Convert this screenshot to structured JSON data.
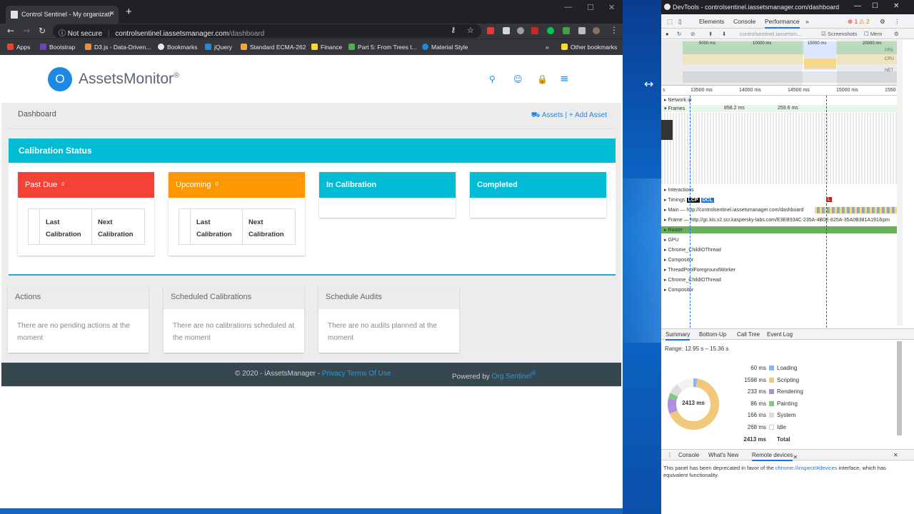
{
  "browser": {
    "tab_title": "Control Sentinel - My organizati",
    "security_label": "Not secure",
    "url_host": "controlsentinel.iassetsmanager.com",
    "url_path": "/dashboard",
    "bookmarks": [
      "Apps",
      "Bootstrap",
      "D3.js - Data-Driven...",
      "Bookmarks",
      "jQuery",
      "Standard ECMA-262",
      "Finance",
      "Part 5: From Trees t...",
      "Material Style"
    ],
    "other_bookmarks": "Other bookmarks"
  },
  "app": {
    "logo_letter": "O",
    "logo_text": "AssetsMonitor",
    "logo_mark": "®",
    "breadcrumb": "Dashboard",
    "assets_link": "Assets",
    "link_sep": "| +",
    "add_asset_link": "Add Asset",
    "calibration": {
      "title": "Calibration Status",
      "cards": [
        {
          "label": "Past Due",
          "count": "0",
          "color": "#f44336",
          "col1": "Last Calibration",
          "col2": "Next Calibration"
        },
        {
          "label": "Upcoming",
          "count": "0",
          "color": "#ff9800",
          "col1": "Last Calibration",
          "col2": "Next Calibration"
        },
        {
          "label": "In Calibration",
          "count": "",
          "color": "#00bcd4"
        },
        {
          "label": "Completed",
          "count": "",
          "color": "#00bcd4"
        }
      ]
    },
    "panels": [
      {
        "title": "Actions",
        "body": "There are no pending actions at the moment"
      },
      {
        "title": "Scheduled Calibrations",
        "body": "There are no calibrations scheduled at the moment"
      },
      {
        "title": "Schedule Audits",
        "body": "There are no audits planned at the moment"
      }
    ],
    "footer": {
      "copy": "© 2020 - iAssetsManager - ",
      "privacy": "Privacy",
      "terms": "Terms Of Use",
      "powered": "Powered by ",
      "org": "Org Sentinel",
      "org_mark": "®"
    }
  },
  "devtools": {
    "title": "DevTools - controlsentinel.iassetsmanager.com/dashboard",
    "tabs": [
      "Elements",
      "Console",
      "Performance"
    ],
    "errors": "1",
    "warnings": "2",
    "toolbar_url": "controlsentinel.iassetsm...",
    "screenshots_label": "Screenshots",
    "memory_label": "Mem",
    "overview_labels": [
      "5000 ms",
      "10000 ms",
      "15000 ms",
      "20000 ms"
    ],
    "lane_labels": [
      "FPS",
      "CPU",
      "NET"
    ],
    "ruler": [
      "s",
      "13500 ms",
      "14000 ms",
      "14500 ms",
      "15000 ms",
      "1550"
    ],
    "tracks": {
      "network": "Network ip",
      "frames": "Frames",
      "frame_times": [
        "858.2 ms",
        "259.6 ms"
      ],
      "interactions": "Interactions",
      "timings": "Timings",
      "lcp": "LCP",
      "dcl": "DCL",
      "l": "L",
      "main": "Main — http://controlsentinel.iassetsmanager.com/dashboard",
      "frame": "Frame — http://gc.kis.v2.scr.kaspersky-labs.com/E3EB934C-235A-4B0E-825A-35A0B381A191/kpm",
      "raster": "Raster",
      "gpu": "GPU",
      "threads": [
        "Chrome_ChildIOThread",
        "Compositor",
        "ThreadPoolForegroundWorker",
        "Chrome_ChildIOThread",
        "Compositor"
      ]
    },
    "summary_tabs": [
      "Summary",
      "Bottom-Up",
      "Call Tree",
      "Event Log"
    ],
    "range": "Range: 12.95 s – 15.36 s",
    "donut_center": "2413 ms",
    "breakdown": [
      {
        "ms": "60 ms",
        "label": "Loading",
        "color": "#8ab4f8",
        "value": 60
      },
      {
        "ms": "1598 ms",
        "label": "Scripting",
        "color": "#f2c97a",
        "value": 1598
      },
      {
        "ms": "233 ms",
        "label": "Rendering",
        "color": "#af8fe0",
        "value": 233
      },
      {
        "ms": "86 ms",
        "label": "Painting",
        "color": "#81c784",
        "value": 86
      },
      {
        "ms": "166 ms",
        "label": "System",
        "color": "#dadce0",
        "value": 166
      },
      {
        "ms": "268 ms",
        "label": "Idle",
        "color": "#ffffff",
        "value": 268
      }
    ],
    "total_ms": "2413 ms",
    "total_label": "Total",
    "drawer_tabs": [
      "Console",
      "What's New",
      "Remote devices"
    ],
    "deprecation_text": "This panel has been deprecated in favor of the ",
    "deprecation_link": "chrome://inspect/#devices",
    "deprecation_tail": " interface, which has equivalent functionality."
  }
}
